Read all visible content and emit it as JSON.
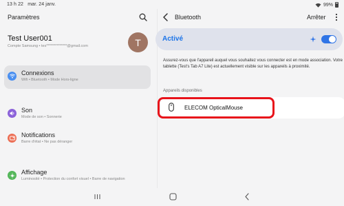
{
  "status_bar": {
    "time": "13 h 22",
    "date": "mar. 24 janv.",
    "battery": "99%"
  },
  "left": {
    "title": "Paramètres",
    "account": {
      "name": "Test User001",
      "subtitle": "Compte Samsung  •  tes**************@gmail.com",
      "avatar_letter": "T"
    },
    "menu": [
      {
        "title": "Connexions",
        "subtitle": "Wifi  •  Bluetooth  •  Mode Hors-ligne",
        "icon": "wifi-icon",
        "color": "#4a8ff0"
      },
      {
        "title": "Son",
        "subtitle": "Mode de son  •  Sonnerie",
        "icon": "volume-icon",
        "color": "#8b62d9"
      },
      {
        "title": "Notifications",
        "subtitle": "Barre d'état  •  Ne pas déranger",
        "icon": "notification-icon",
        "color": "#ec6f55"
      },
      {
        "title": "Affichage",
        "subtitle": "Luminosité  •  Protection du confort visuel  •  Barre de navigation",
        "icon": "display-icon",
        "color": "#54b65a"
      }
    ]
  },
  "right": {
    "title": "Bluetooth",
    "stop_label": "Arrêter",
    "status_label": "Activé",
    "toggle_on": true,
    "description": "Assurez-vous que l'appareil auquel vous souhaitez vous connecter est en mode association. Votre tablette (Test's Tab A7 Lite) est actuellement visible sur les appareils à proximité.",
    "section_label": "Appareils disponibles",
    "devices": [
      {
        "name": "ELECOM OpticalMouse",
        "icon": "mouse-icon"
      }
    ]
  },
  "colors": {
    "accent": "#1a73e8",
    "toggle": "#2f74e6",
    "highlight": "#e8121a"
  }
}
